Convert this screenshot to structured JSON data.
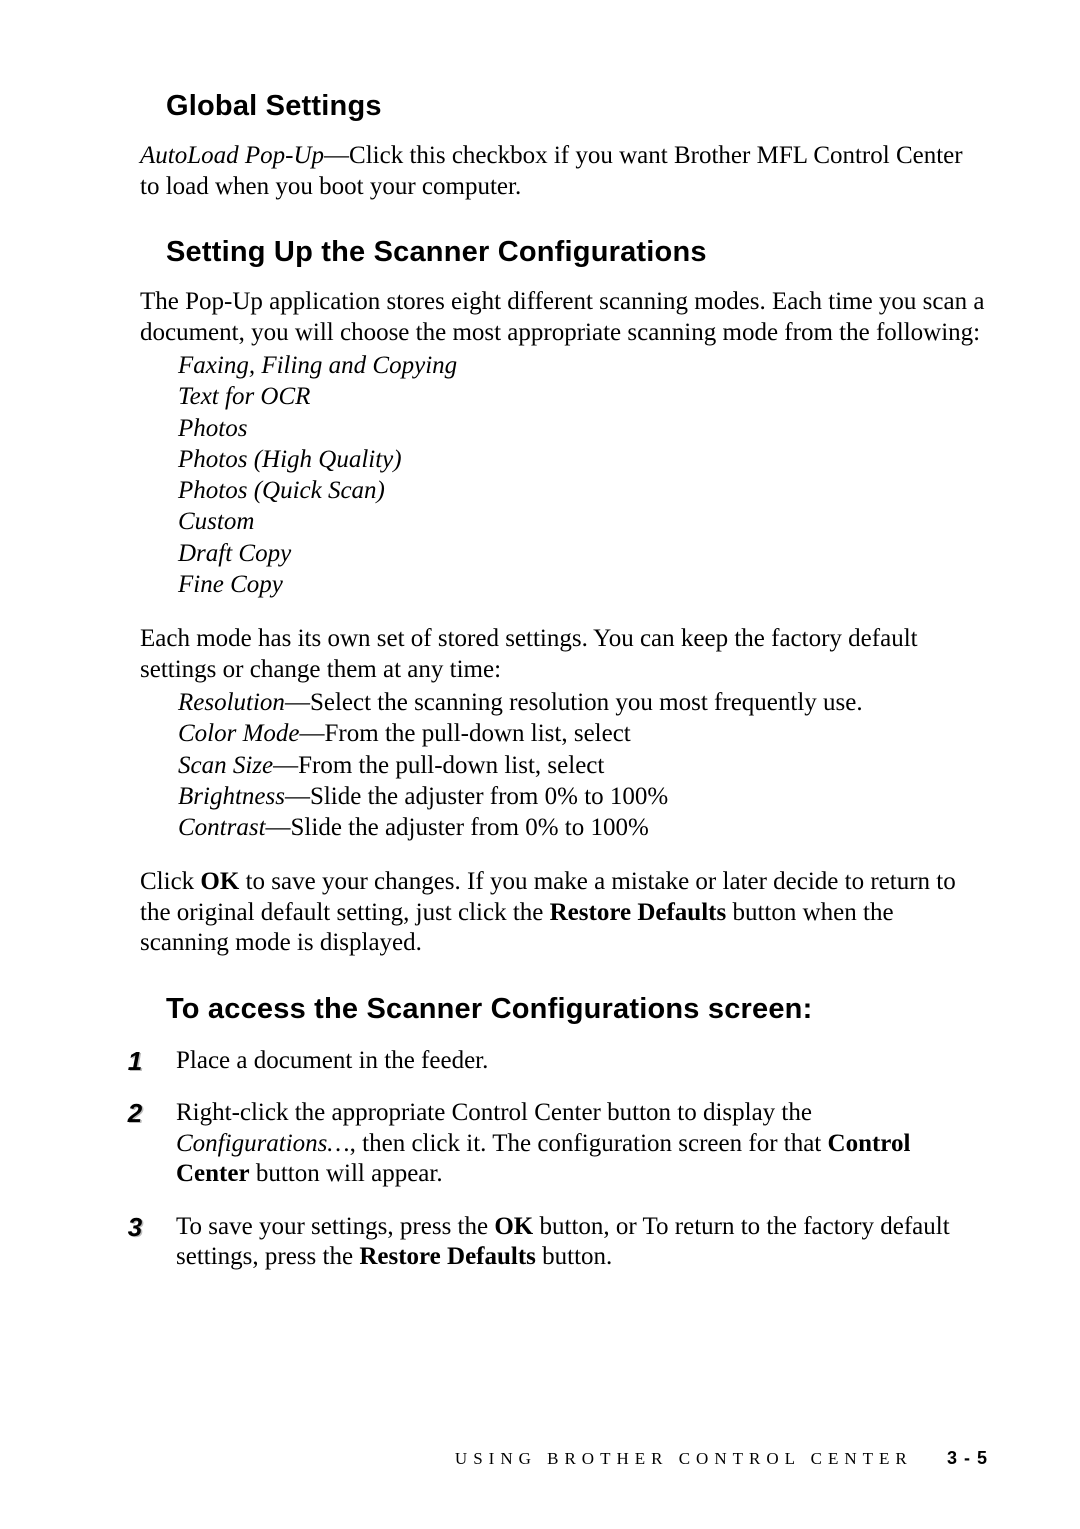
{
  "section1": {
    "heading": "Global Settings",
    "para_html": "<em>AutoLoad Pop-Up</em>—Click this checkbox if you want Brother MFL Control Center to load when you boot your computer."
  },
  "section2": {
    "heading": "Setting Up the Scanner Configurations",
    "intro": "The Pop-Up application stores eight different scanning modes. Each time you scan a document, you will choose the most appropriate scanning mode from the following:",
    "modes": [
      "Faxing, Filing and Copying",
      "Text for OCR",
      "Photos",
      "Photos (High Quality)",
      "Photos (Quick Scan)",
      "Custom",
      "Draft Copy",
      "Fine Copy"
    ],
    "stored_intro": "Each mode has its own set of stored settings. You can keep the factory default settings or change them at any time:",
    "settings": [
      {
        "name": "Resolution",
        "desc": "—Select the scanning resolution you most frequently use."
      },
      {
        "name": "Color Mode",
        "desc": "—From the pull-down list, select"
      },
      {
        "name": "Scan Size",
        "desc": "—From the pull-down list, select"
      },
      {
        "name": "Brightness",
        "desc": "—Slide the adjuster from 0% to 100%"
      },
      {
        "name": "Contrast",
        "desc": "—Slide the adjuster from 0% to 100%"
      }
    ],
    "closing_html": "Click <span class=\"bold\">OK</span> to save your changes. If you make a mistake or later decide to return to the original default setting, just click the <span class=\"bold\">Restore Defaults</span> button when the scanning mode is displayed."
  },
  "section3": {
    "heading": "To access the Scanner Configurations screen:",
    "steps": [
      {
        "num": "1",
        "html": "Place a document in the feeder."
      },
      {
        "num": "2",
        "html": "Right-click the appropriate Control Center button to display the <em>Configurations…</em>, then click it. The configuration screen for that <span class=\"bold\">Control Center</span> button will appear."
      },
      {
        "num": "3",
        "html": "To save your settings, press the <span class=\"bold\">OK</span> button, or To return to the factory default settings, press the <span class=\"bold\">Restore Defaults</span> button."
      }
    ]
  },
  "footer": {
    "running": "USING BROTHER CONTROL CENTER",
    "page": "3 - 5"
  }
}
